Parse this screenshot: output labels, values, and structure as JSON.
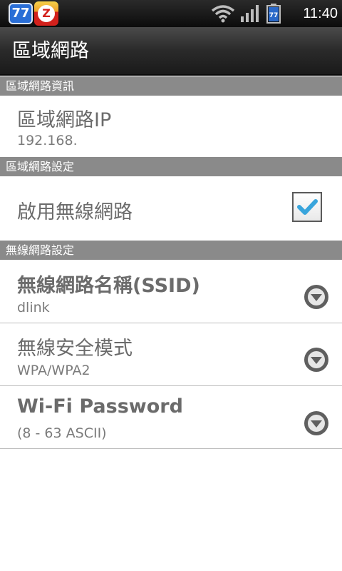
{
  "status_bar": {
    "notification_badge": "77",
    "notification_app_letter": "Z",
    "battery_label": "77",
    "time": "11:40",
    "icons": [
      "wifi-icon",
      "signal-icon",
      "battery-icon"
    ]
  },
  "header": {
    "title": "區域網路"
  },
  "sections": {
    "lan_info": {
      "header": "區域網路資訊",
      "lan_ip": {
        "title": "區域網路IP",
        "value": "192.168."
      }
    },
    "lan_settings": {
      "header": "區域網路設定",
      "enable_wifi": {
        "title": "啟用無線網路",
        "checked": true
      }
    },
    "wifi_settings": {
      "header": "無線網路設定",
      "ssid": {
        "title": "無線網路名稱(SSID)",
        "value": "dlink"
      },
      "security_mode": {
        "title": "無線安全模式",
        "value": "WPA/WPA2"
      },
      "password": {
        "title": "Wi-Fi Password",
        "value": "(8 - 63 ASCII)"
      }
    }
  },
  "colors": {
    "section_header_bg": "#8a8a8a",
    "title_bar_bg": "#2a2a2a",
    "check_accent": "#39a5dc",
    "text_primary": "#6b6b6b"
  }
}
